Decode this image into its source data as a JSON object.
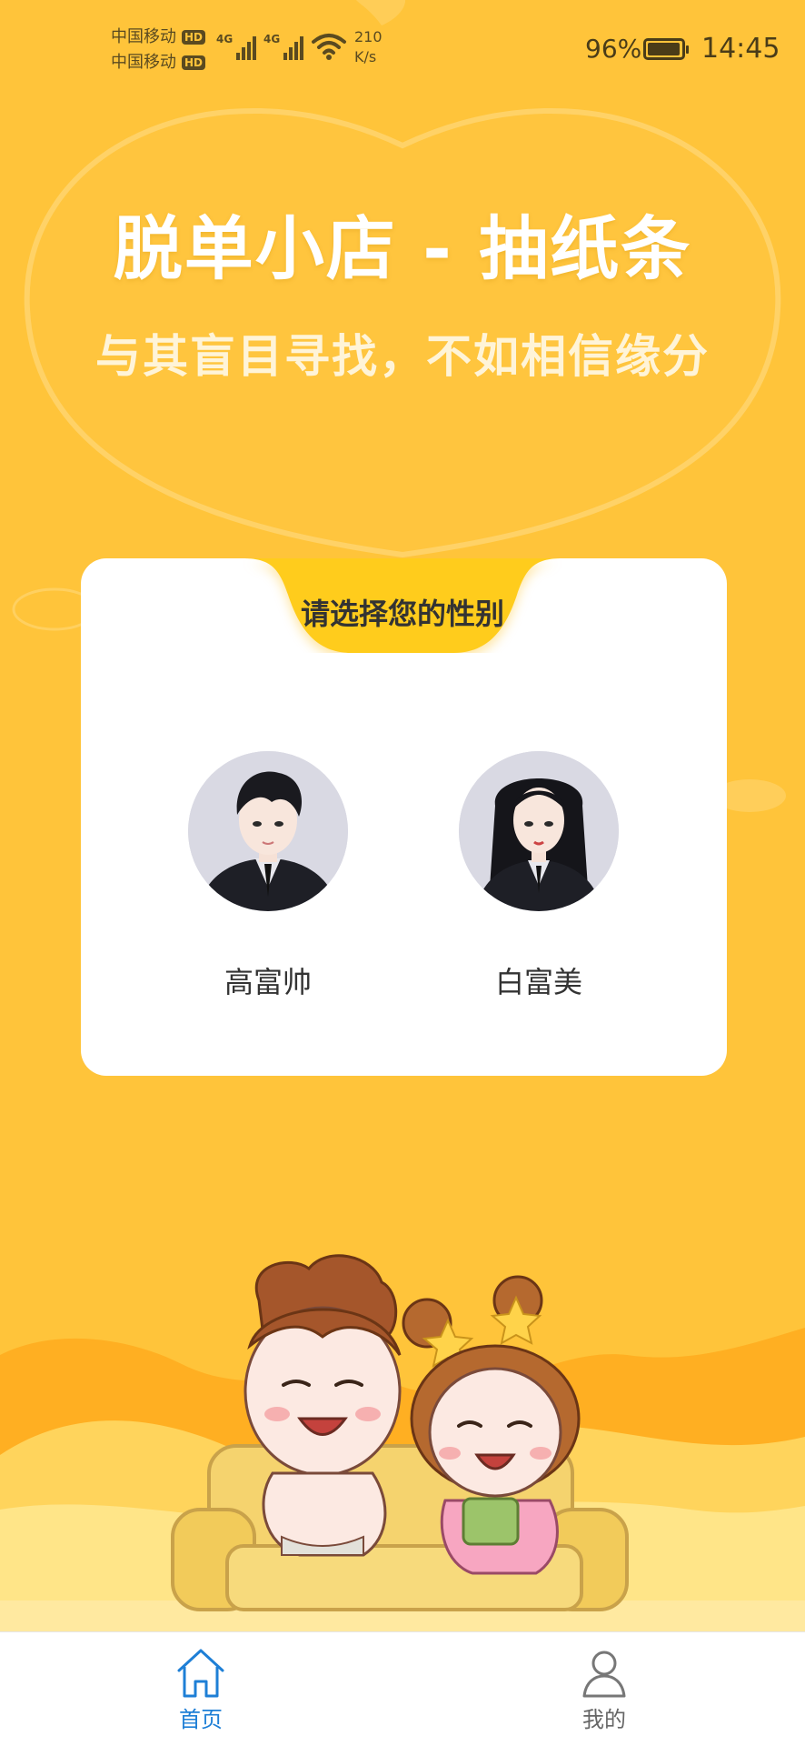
{
  "status_bar": {
    "carrier1": "中国移动",
    "carrier2": "中国移动",
    "hd": "HD",
    "signal_label": "4G",
    "net_speed_value": "210",
    "net_speed_unit": "K/s",
    "battery_percent": "96%",
    "battery_level": 0.96,
    "time": "14:45"
  },
  "header": {
    "title": "脱单小店 - 抽纸条",
    "subtitle": "与其盲目寻找，不如相信缘分"
  },
  "gender_card": {
    "prompt": "请选择您的性别",
    "options": [
      {
        "label": "高富帅",
        "icon": "male-avatar"
      },
      {
        "label": "白富美",
        "icon": "female-avatar"
      }
    ]
  },
  "bottom_nav": {
    "items": [
      {
        "label": "首页",
        "icon": "home-icon",
        "active": true
      },
      {
        "label": "我的",
        "icon": "user-icon",
        "active": false
      }
    ]
  },
  "colors": {
    "background": "#FFC43A",
    "accent_tab": "#FFCC1A",
    "active_nav": "#1E7FD6",
    "card": "#FFFFFF"
  }
}
